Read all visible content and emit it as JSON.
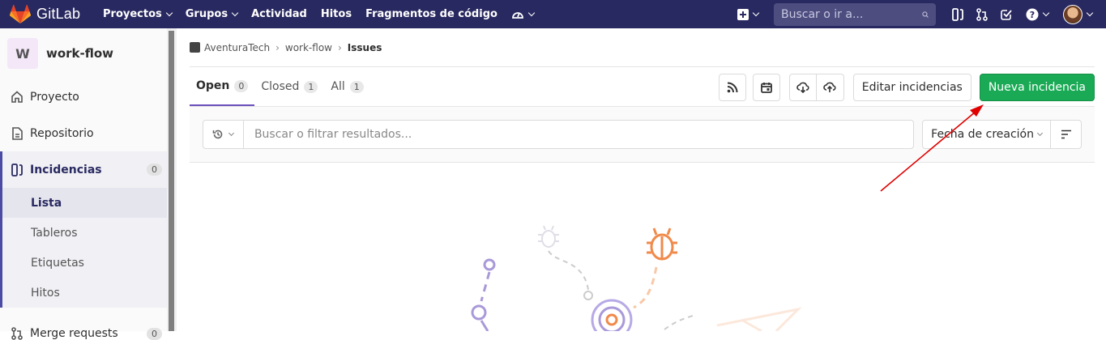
{
  "navbar": {
    "brand": "GitLab",
    "menu": [
      "Proyectos",
      "Grupos",
      "Actividad",
      "Hitos",
      "Fragmentos de código"
    ],
    "search_placeholder": "Buscar o ir a...",
    "icons": [
      "plus-icon",
      "search-icon",
      "issues-icon",
      "merge-request-icon",
      "todos-icon",
      "help-icon",
      "avatar"
    ]
  },
  "sidebar": {
    "project_initial": "W",
    "project_name": "work-flow",
    "items": [
      {
        "label": "Proyecto",
        "icon": "home-icon"
      },
      {
        "label": "Repositorio",
        "icon": "doc-icon"
      },
      {
        "label": "Incidencias",
        "icon": "issues-icon",
        "badge": "0"
      },
      {
        "label": "Merge requests",
        "icon": "merge-request-icon",
        "badge": "0"
      }
    ],
    "subitems": [
      "Lista",
      "Tableros",
      "Etiquetas",
      "Hitos"
    ]
  },
  "breadcrumb": {
    "group": "AventuraTech",
    "project": "work-flow",
    "current": "Issues"
  },
  "tabs": [
    {
      "label": "Open",
      "count": "0"
    },
    {
      "label": "Closed",
      "count": "1"
    },
    {
      "label": "All",
      "count": "1"
    }
  ],
  "actions": {
    "edit_label": "Editar incidencias",
    "new_label": "Nueva incidencia"
  },
  "filter": {
    "placeholder": "Buscar o filtrar resultados...",
    "sort_label": "Fecha de creación"
  },
  "colors": {
    "navbar": "#292961",
    "accent": "#6b4fbb",
    "primary_button": "#1aaa55",
    "annotation_arrow": "#e00000"
  }
}
